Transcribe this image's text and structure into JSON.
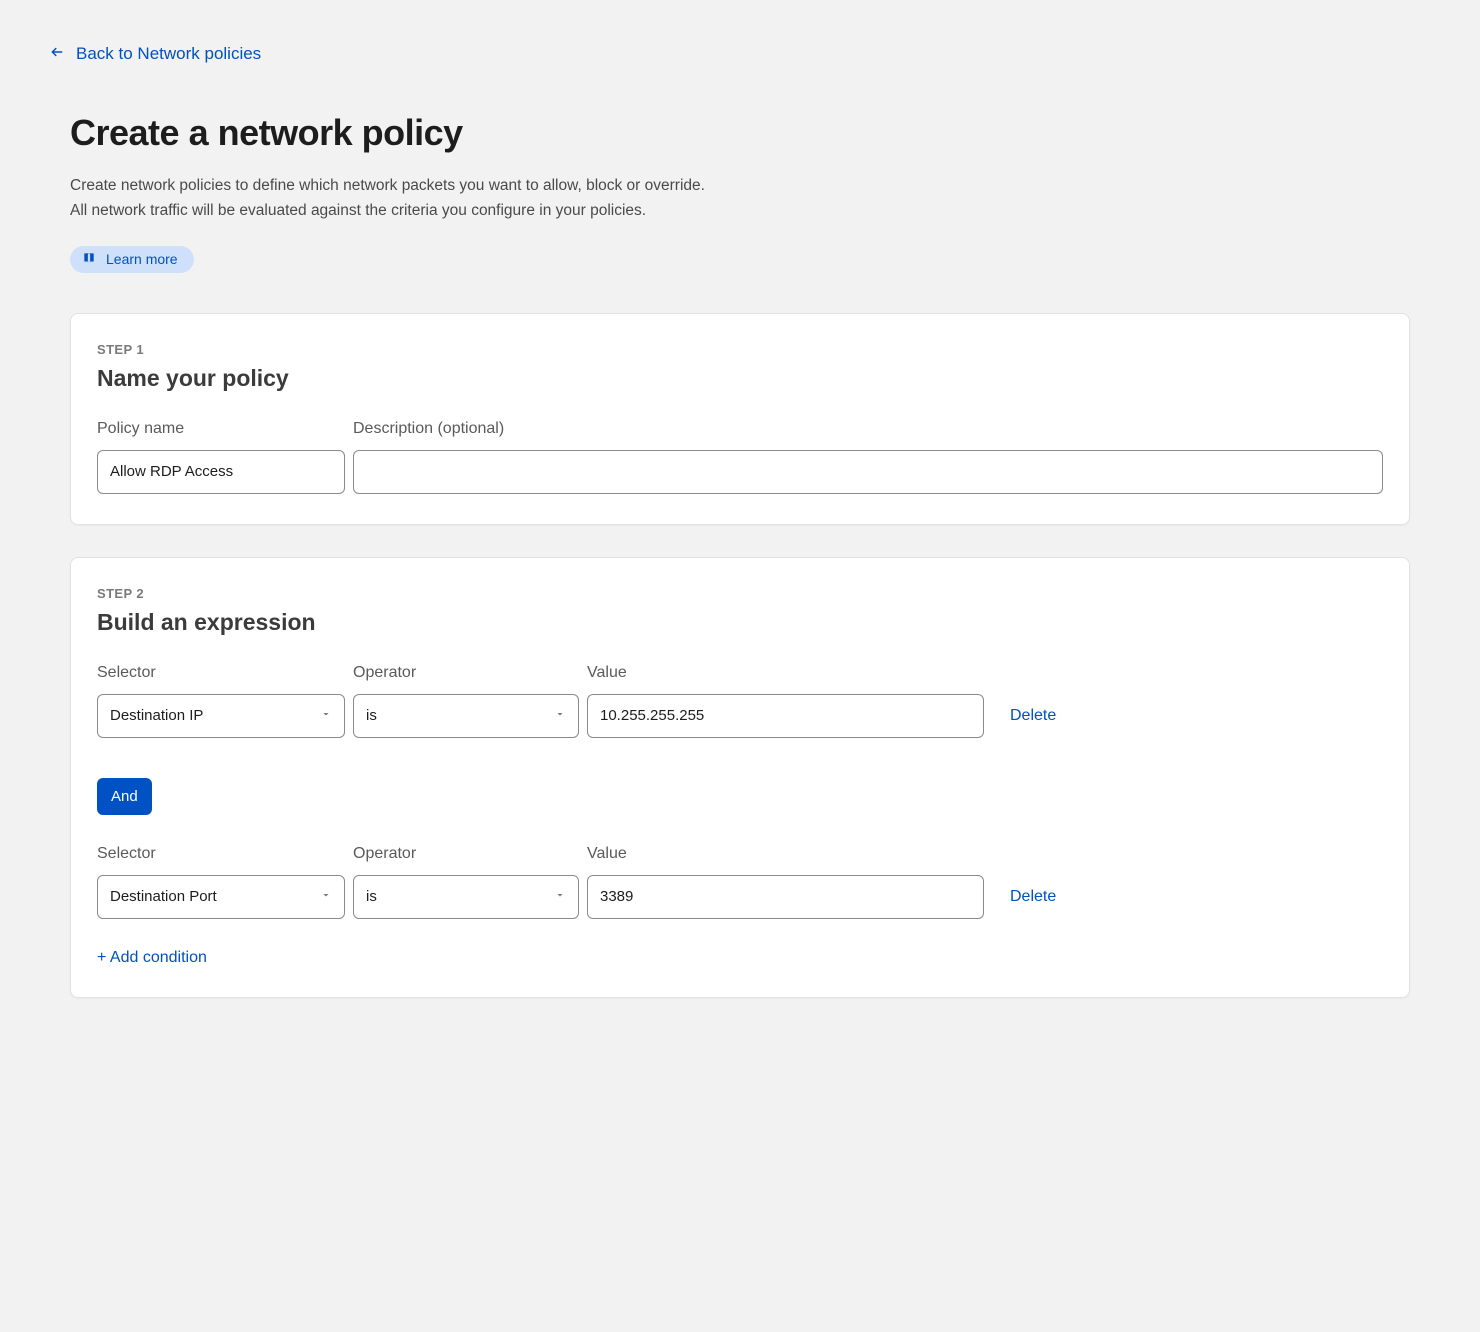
{
  "back_link": "Back to Network policies",
  "page_title": "Create a network policy",
  "page_desc": "Create network policies to define which network packets you want to allow, block or override. All network traffic will be evaluated against the criteria you configure in your policies.",
  "learn_more": "Learn more",
  "step1": {
    "eyebrow": "STEP 1",
    "title": "Name your policy",
    "policy_name_label": "Policy name",
    "policy_name_value": "Allow RDP Access",
    "description_label": "Description (optional)",
    "description_value": ""
  },
  "step2": {
    "eyebrow": "STEP 2",
    "title": "Build an expression",
    "labels": {
      "selector": "Selector",
      "operator": "Operator",
      "value": "Value",
      "delete": "Delete",
      "and": "And",
      "add_condition": "+ Add condition"
    },
    "rows": [
      {
        "selector": "Destination IP",
        "operator": "is",
        "value": "10.255.255.255"
      },
      {
        "selector": "Destination Port",
        "operator": "is",
        "value": "3389"
      }
    ]
  }
}
